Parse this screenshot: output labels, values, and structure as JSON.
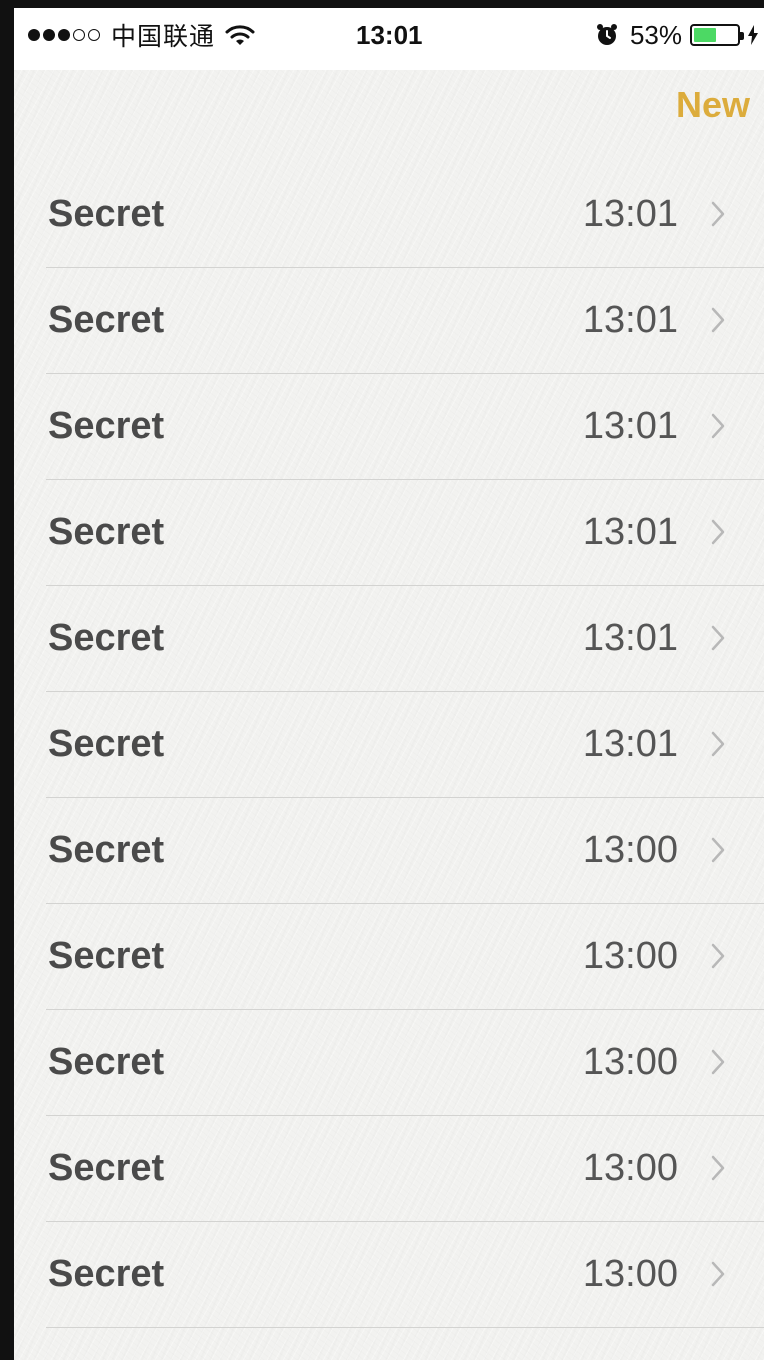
{
  "status_bar": {
    "signal_full": 3,
    "signal_total": 5,
    "carrier": "中国联通",
    "wifi_icon": "wifi-icon",
    "time": "13:01",
    "alarm_icon": "alarm-clock-icon",
    "battery_percent": "53%",
    "battery_level": 0.53,
    "battery_color": "#4cd964",
    "charging_icon": "lightning-bolt-icon"
  },
  "nav": {
    "new_label": "New",
    "accent_color": "#dcac3c"
  },
  "notes": [
    {
      "title": "Secret",
      "time": "13:01"
    },
    {
      "title": "Secret",
      "time": "13:01"
    },
    {
      "title": "Secret",
      "time": "13:01"
    },
    {
      "title": "Secret",
      "time": "13:01"
    },
    {
      "title": "Secret",
      "time": "13:01"
    },
    {
      "title": "Secret",
      "time": "13:01"
    },
    {
      "title": "Secret",
      "time": "13:00"
    },
    {
      "title": "Secret",
      "time": "13:00"
    },
    {
      "title": "Secret",
      "time": "13:00"
    },
    {
      "title": "Secret",
      "time": "13:00"
    },
    {
      "title": "Secret",
      "time": "13:00"
    }
  ],
  "row_chevron_icon": "chevron-right-icon"
}
